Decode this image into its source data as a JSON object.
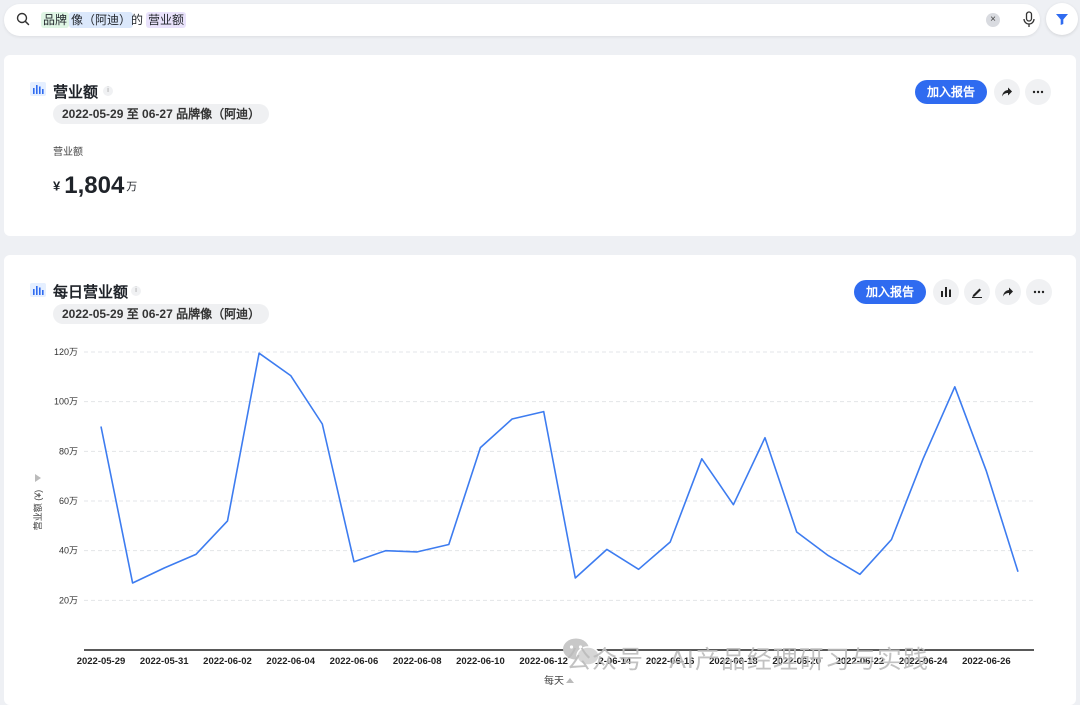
{
  "search": {
    "tokens": [
      {
        "text": "品牌",
        "style": "green"
      },
      {
        "text": "像（阿迪）",
        "style": "blue"
      },
      {
        "text": "的",
        "style": "plain"
      },
      {
        "text": "营业额",
        "style": "purple"
      }
    ],
    "clear_label": "×"
  },
  "card1": {
    "title": "营业额",
    "info": "i",
    "filter_pill": "2022-05-29 至 06-27 品牌像（阿迪）",
    "add_report_label": "加入报告",
    "metric_label": "营业额",
    "currency": "¥",
    "value": "1,804",
    "unit": "万"
  },
  "card2": {
    "title": "每日营业额",
    "info": "i",
    "filter_pill": "2022-05-29 至 06-27 品牌像（阿迪）",
    "add_report_label": "加入报告"
  },
  "watermark": "公众号 · AI产品经理研习与实践",
  "colors": {
    "accent": "#2f6bf0",
    "line": "#3d7cf0",
    "grid": "#e3e5e8"
  },
  "chart_data": {
    "type": "line",
    "x": [
      "2022-05-29",
      "2022-05-30",
      "2022-05-31",
      "2022-06-01",
      "2022-06-02",
      "2022-06-03",
      "2022-06-04",
      "2022-06-05",
      "2022-06-06",
      "2022-06-07",
      "2022-06-08",
      "2022-06-09",
      "2022-06-10",
      "2022-06-11",
      "2022-06-12",
      "2022-06-13",
      "2022-06-14",
      "2022-06-15",
      "2022-06-16",
      "2022-06-17",
      "2022-06-18",
      "2022-06-19",
      "2022-06-20",
      "2022-06-21",
      "2022-06-22",
      "2022-06-23",
      "2022-06-24",
      "2022-06-25",
      "2022-06-26",
      "2022-06-27"
    ],
    "x_tick_labels": [
      "2022-05-29",
      "2022-05-31",
      "2022-06-02",
      "2022-06-04",
      "2022-06-06",
      "2022-06-08",
      "2022-06-10",
      "2022-06-12",
      "2022-06-14",
      "2022-06-16",
      "2022-06-18",
      "2022-06-20",
      "2022-06-22",
      "2022-06-24",
      "2022-06-26"
    ],
    "series": [
      {
        "values": [
          90,
          27,
          33,
          38.5,
          52,
          119.5,
          110.5,
          91,
          35.5,
          40,
          39.5,
          42.5,
          81.5,
          93,
          96,
          29,
          40.5,
          32.5,
          43.5,
          77,
          58.5,
          85.5,
          47.5,
          38,
          30.5,
          44.5,
          77,
          106,
          72,
          31.5
        ]
      }
    ],
    "y_ticks": [
      "20万",
      "40万",
      "60万",
      "80万",
      "100万",
      "120万"
    ],
    "ylim": [
      0,
      120
    ],
    "ylabel": "营业额 (¥)",
    "xlabel": "每天",
    "grid": true,
    "legend": "none"
  }
}
